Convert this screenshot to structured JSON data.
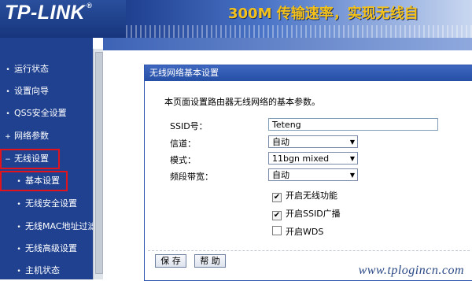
{
  "header": {
    "logo_text": "TP-LINK",
    "logo_mark": "®",
    "slogan": "300M 传输速率，实现无线自"
  },
  "sidebar": {
    "items": [
      {
        "label": "运行状态",
        "bullet": "•"
      },
      {
        "label": "设置向导",
        "bullet": "•"
      },
      {
        "label": "QSS安全设置",
        "bullet": "•"
      },
      {
        "label": "网络参数",
        "bullet": "+"
      },
      {
        "label": "无线设置",
        "bullet": "−"
      },
      {
        "label": "基本设置",
        "bullet": "•"
      },
      {
        "label": "无线安全设置",
        "bullet": "•"
      },
      {
        "label": "无线MAC地址过滤",
        "bullet": "•"
      },
      {
        "label": "无线高级设置",
        "bullet": "•"
      },
      {
        "label": "主机状态",
        "bullet": "•"
      }
    ]
  },
  "panel": {
    "title": "无线网络基本设置",
    "description": "本页面设置路由器无线网络的基本参数。",
    "ssid": {
      "label": "SSID号：",
      "value": "Teteng"
    },
    "channel": {
      "label": "信道：",
      "value": "自动"
    },
    "mode": {
      "label": "模式：",
      "value": "11bgn mixed"
    },
    "bandwidth": {
      "label": "频段带宽：",
      "value": "自动"
    },
    "checks": [
      {
        "label": "开启无线功能",
        "checked": true,
        "mark": "✔"
      },
      {
        "label": "开启SSID广播",
        "checked": true,
        "mark": "✔"
      },
      {
        "label": "开启WDS",
        "checked": false,
        "mark": ""
      }
    ],
    "buttons": {
      "save": "保 存",
      "help": "帮 助"
    }
  },
  "watermark": "www.tplogincn.com",
  "colors": {
    "sidebar_bg": "#1f4190",
    "highlight": "#e1141e",
    "panel_title_bg": "#2c56ad",
    "slogan": "#f3c11a"
  }
}
